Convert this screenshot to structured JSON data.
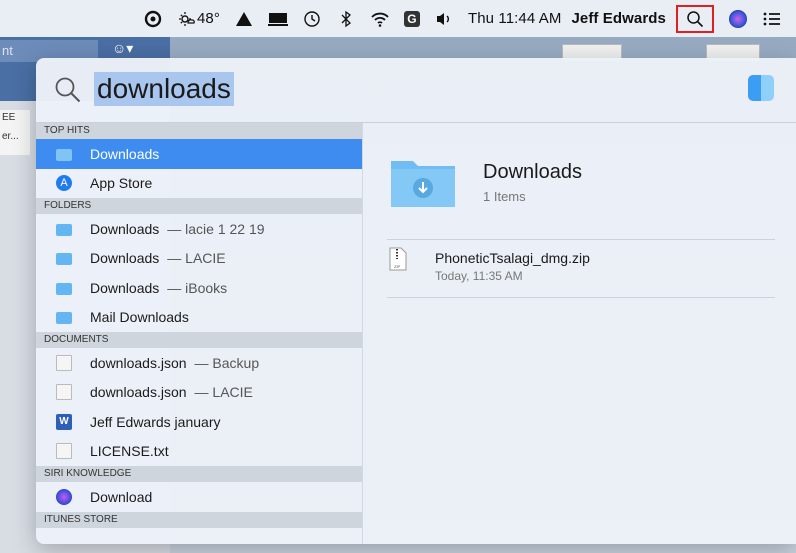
{
  "menubar": {
    "weather": "48°",
    "clock": "Thu 11:44 AM",
    "user": "Jeff Edwards",
    "grammarly_letter": "G"
  },
  "background": {
    "field_text": "nt",
    "side_text_1": "EE",
    "side_text_2": "er..."
  },
  "spotlight": {
    "query": "downloads",
    "sections": {
      "top_hits": "TOP HITS",
      "folders": "FOLDERS",
      "documents": "DOCUMENTS",
      "siri": "SIRI KNOWLEDGE",
      "itunes": "ITUNES STORE"
    },
    "top_hits": [
      {
        "label": "Downloads",
        "icon": "folder-icon",
        "selected": true
      },
      {
        "label": "App Store",
        "icon": "app-store-icon"
      }
    ],
    "folders": [
      {
        "label": "Downloads",
        "sub": "— lacie 1 22 19"
      },
      {
        "label": "Downloads",
        "sub": "— LACIE"
      },
      {
        "label": "Downloads",
        "sub": "— iBooks"
      },
      {
        "label": "Mail Downloads",
        "sub": ""
      }
    ],
    "documents": [
      {
        "label": "downloads.json",
        "sub": "— Backup"
      },
      {
        "label": "downloads.json",
        "sub": "— LACIE"
      },
      {
        "label": "Jeff Edwards january",
        "sub": ""
      },
      {
        "label": "LICENSE.txt",
        "sub": ""
      }
    ],
    "siri_items": [
      {
        "label": "Download"
      }
    ],
    "preview": {
      "title": "Downloads",
      "subtitle": "1 Items",
      "file_name": "PhoneticTsalagi_dmg.zip",
      "file_date": "Today, 11:35 AM",
      "zip_label": "ZIP"
    },
    "colors": {
      "selection": "#3f8cf0",
      "folder": "#63b6f2",
      "query_highlight": "#a9c6ee"
    }
  }
}
